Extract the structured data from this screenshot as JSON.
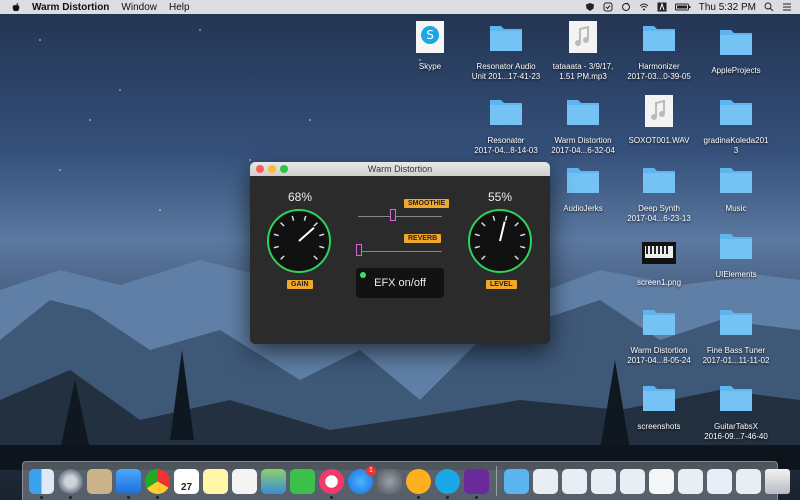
{
  "menubar": {
    "app_name": "Warm Distortion",
    "menus": [
      "Window",
      "Help"
    ],
    "clock": "Thu 5:32 PM"
  },
  "desktop_icons": [
    {
      "label": "Skype",
      "type": "app"
    },
    {
      "label": "Resonator Audio\nUnit 201...17-41-23",
      "type": "folder"
    },
    {
      "label": "tataaata - 3/9/17,\n1.51 PM.mp3",
      "type": "audio"
    },
    {
      "label": "Harmonizer\n2017-03...0-39-05",
      "type": "folder"
    },
    {
      "label": "AppleProjects",
      "type": "folder"
    },
    {
      "label": "Resonator\n2017-04...8-14-03",
      "type": "folder"
    },
    {
      "label": "Warm Distortion\n2017-04...6-32-04",
      "type": "folder"
    },
    {
      "label": "SOXOT001.WAV",
      "type": "audio"
    },
    {
      "label": "gradinaKoleda201\n3",
      "type": "folder"
    },
    {
      "label": "AudioJerks",
      "type": "folder"
    },
    {
      "label": "Deep Synth\n2017-04...6-23-13",
      "type": "folder"
    },
    {
      "label": "Music",
      "type": "folder"
    },
    {
      "label": "screen1.png",
      "type": "image"
    },
    {
      "label": "UIElements",
      "type": "folder"
    },
    {
      "label": "Warm Distortion\n2017-04...8-05-24",
      "type": "folder"
    },
    {
      "label": "Fine Bass Tuner\n2017-01...11-11-02",
      "type": "folder"
    },
    {
      "label": "screenshots",
      "type": "folder"
    },
    {
      "label": "GuitarTabsX\n2016-09...7-46-40",
      "type": "folder"
    }
  ],
  "plugin": {
    "title": "Warm Distortion",
    "gain": {
      "value": "68%",
      "label": "GAIN",
      "level": 0.68
    },
    "level": {
      "value": "55%",
      "label": "LEVEL",
      "level": 0.55
    },
    "smoothie": {
      "label": "SMOOTHIE",
      "level": 0.4
    },
    "reverb": {
      "label": "REVERB",
      "level": 0.0
    },
    "efx_button": "EFX on/off"
  },
  "dock": {
    "calendar_day": "27",
    "app_store_badge": "1",
    "colors": {
      "accent": "#f1a72c",
      "knob_ring": "#2fd35a",
      "slider": "#e060e0"
    }
  }
}
